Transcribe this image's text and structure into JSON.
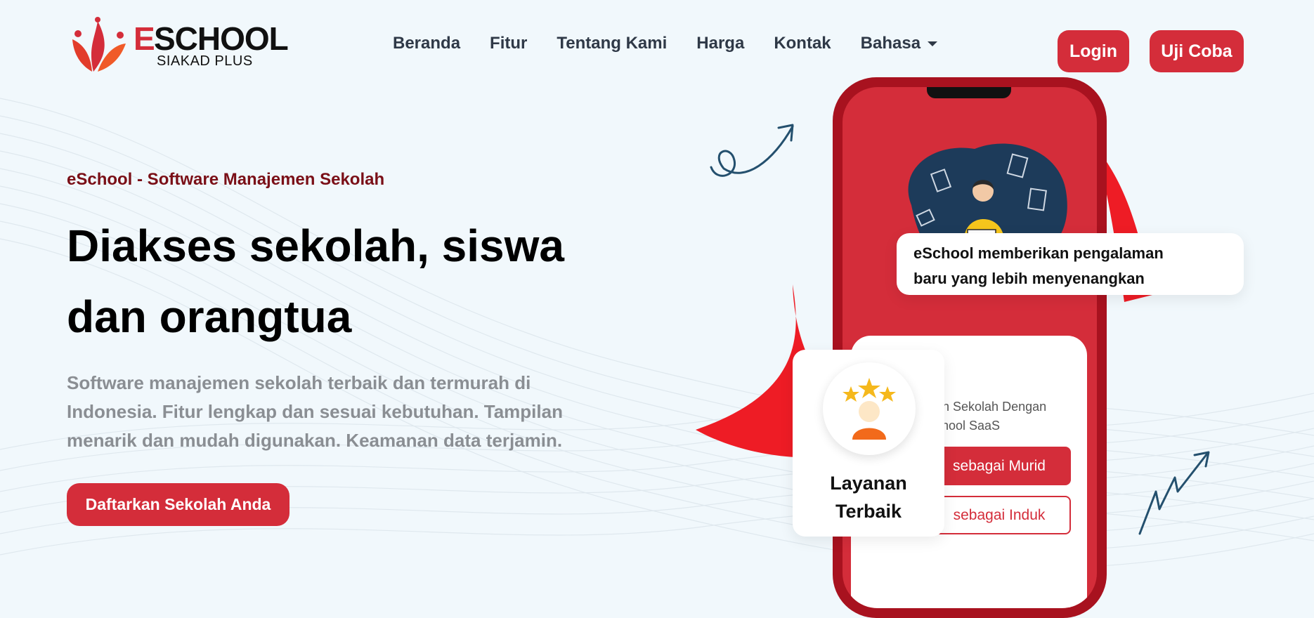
{
  "brand": {
    "name_initial": "E",
    "name_rest": "SCHOOL",
    "subtitle": "SIAKAD PLUS",
    "accent_color": "#d42d3a"
  },
  "nav": {
    "items": [
      {
        "label": "Beranda"
      },
      {
        "label": "Fitur"
      },
      {
        "label": "Tentang Kami"
      },
      {
        "label": "Harga"
      },
      {
        "label": "Kontak"
      }
    ],
    "language_label": "Bahasa",
    "login_label": "Login",
    "trial_label": "Uji Coba"
  },
  "hero": {
    "eyebrow": "eSchool - Software Manajemen Sekolah",
    "headline_line1": "Diakses sekolah, siswa",
    "headline_line2": "dan orangtua",
    "description": "Software manajemen sekolah terbaik dan termurah di Indonesia. Fitur lengkap dan sesuai kebutuhan. Tampilan menarik dan mudah digunakan. Keamanan data terjamin.",
    "cta_label": "Daftarkan Sekolah Anda"
  },
  "phone": {
    "card_text_line1": "en Sekolah Dengan",
    "card_text_line2": "chool SaaS",
    "button_murid": "sebagai Murid",
    "button_induk": "sebagai Induk"
  },
  "callout": {
    "line1": "eSchool memberikan pengalaman",
    "line2": "baru yang lebih menyenangkan"
  },
  "badge": {
    "line1": "Layanan",
    "line2": "Terbaik",
    "icon": "star-user-icon"
  }
}
